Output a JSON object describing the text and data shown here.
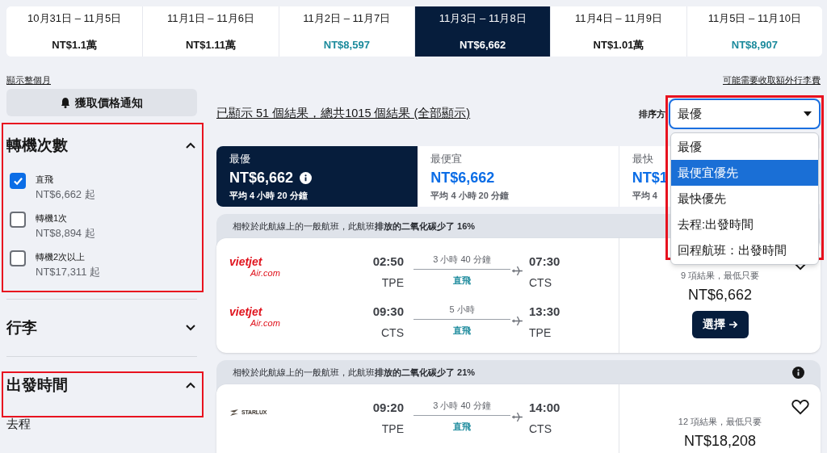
{
  "date_tabs": [
    {
      "dates": "10月31日 – 11月5日",
      "price": "NT$1.1萬",
      "cheap": false,
      "selected": false
    },
    {
      "dates": "11月1日 – 11月6日",
      "price": "NT$1.11萬",
      "cheap": false,
      "selected": false
    },
    {
      "dates": "11月2日 – 11月7日",
      "price": "NT$8,597",
      "cheap": true,
      "selected": false
    },
    {
      "dates": "11月3日 – 11月8日",
      "price": "NT$6,662",
      "selected": true
    },
    {
      "dates": "11月4日 – 11月9日",
      "price": "NT$1.01萬",
      "cheap": false,
      "selected": false
    },
    {
      "dates": "11月5日 – 11月10日",
      "price": "NT$8,907",
      "cheap": true,
      "selected": false
    }
  ],
  "show_month_link": "顯示整個月",
  "baggage_fee_link": "可能需要收取額外行李費",
  "sidebar": {
    "alert_button": "獲取價格通知",
    "sections": [
      {
        "title": "轉機次數",
        "expanded": true,
        "highlighted": true,
        "options": [
          {
            "label": "直飛",
            "price": "NT$6,662 起",
            "checked": true
          },
          {
            "label": "轉機1次",
            "price": "NT$8,894 起",
            "checked": false
          },
          {
            "label": "轉機2次以上",
            "price": "NT$17,311 起",
            "checked": false
          }
        ]
      },
      {
        "title": "行李",
        "expanded": false,
        "highlighted": false
      },
      {
        "title": "出發時間",
        "expanded": true,
        "highlighted": true,
        "subtitle": "去程"
      }
    ]
  },
  "results_summary": "已顯示 51 個結果，總共1015 個結果 (全部顯示)",
  "sort": {
    "label": "排序方",
    "value": "最優",
    "highlighted": true,
    "options": [
      {
        "label": "最優",
        "highlighted": false
      },
      {
        "label": "最便宜優先",
        "highlighted": true
      },
      {
        "label": "最快優先",
        "highlighted": false
      },
      {
        "label": "去程:出發時間",
        "highlighted": false
      },
      {
        "label": "回程航班：出發時間",
        "highlighted": false
      }
    ]
  },
  "sort_tabs": [
    {
      "label": "最優",
      "price": "NT$6,662",
      "duration": "平均 4 小時 20 分鐘",
      "selected": true,
      "info": true
    },
    {
      "label": "最便宜",
      "price": "NT$6,662",
      "duration": "平均 4 小時 20 分鐘",
      "selected": false,
      "info": false
    },
    {
      "label": "最快",
      "price": "NT$1",
      "duration": "平均 4",
      "selected": false,
      "info": false
    }
  ],
  "flights": [
    {
      "eco_note": "相較於此航線上的一般航班，此航班**排放的二氧化碳少了 16%**",
      "favorite": false,
      "legs": [
        {
          "logo": [
            "vietjet",
            "Air.com"
          ],
          "depart": "02:50",
          "from": "TPE",
          "duration": "3 小時 40 分鐘",
          "stops": "直飛",
          "arrive": "07:30",
          "to": "CTS"
        },
        {
          "logo": [
            "vietjet",
            "Air.com"
          ],
          "depart": "09:30",
          "from": "CTS",
          "duration": "5 小時",
          "stops": "直飛",
          "arrive": "13:30",
          "to": "TPE"
        }
      ],
      "deals": "9 項結果，最低只要",
      "price": "NT$6,662",
      "select_button": "選擇"
    },
    {
      "eco_note": "相較於此航線上的一般航班，此航班**排放的二氧化碳少了 21%**",
      "info": true,
      "favorite": false,
      "legs": [
        {
          "logo": [
            "STARLUX"
          ],
          "depart": "09:20",
          "from": "TPE",
          "duration": "3 小時 40 分鐘",
          "stops": "直飛",
          "arrive": "14:00",
          "to": "CTS"
        }
      ],
      "deals": "12 項結果，最低只要",
      "price": "NT$18,208"
    }
  ]
}
